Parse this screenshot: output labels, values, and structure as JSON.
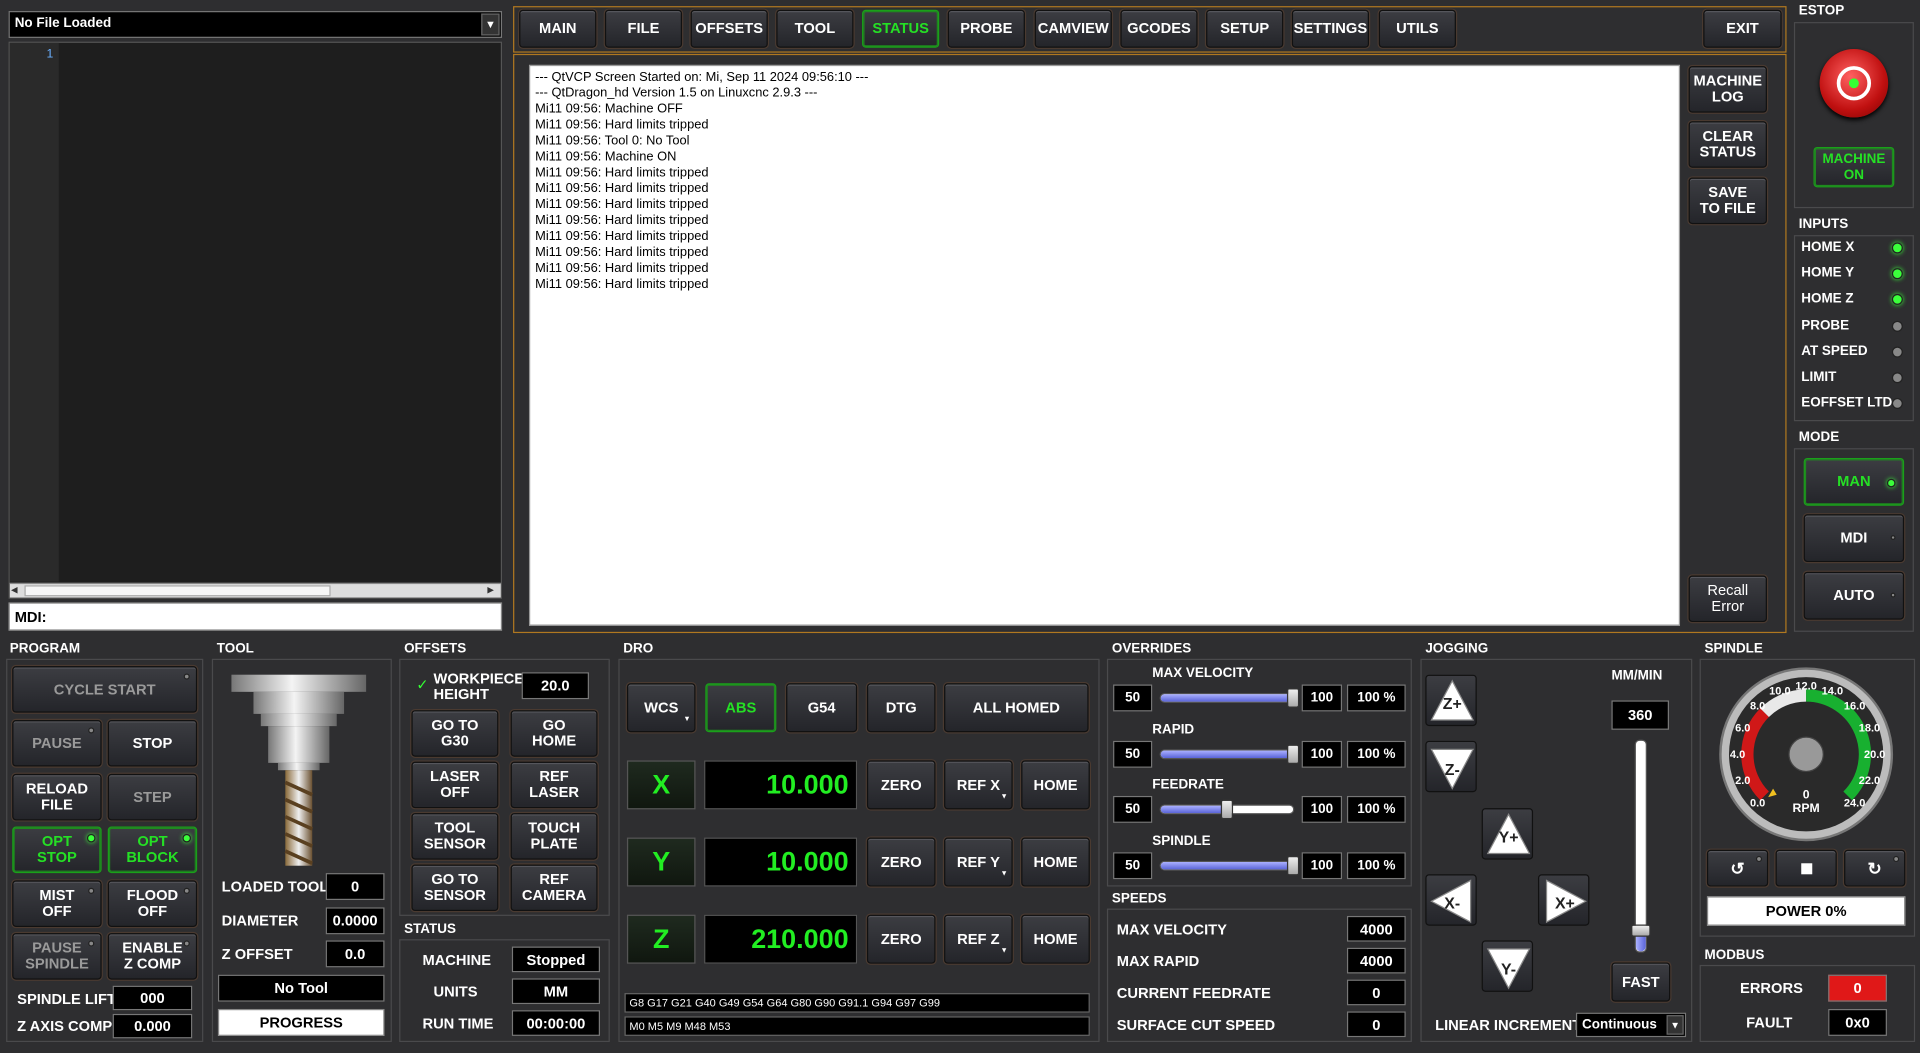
{
  "file": {
    "name": "No File Loaded",
    "line_no": "1",
    "mdi_label": "MDI:"
  },
  "tabs": [
    "MAIN",
    "FILE",
    "OFFSETS",
    "TOOL",
    "STATUS",
    "PROBE",
    "CAMVIEW",
    "GCODES",
    "SETUP",
    "SETTINGS",
    "UTILS"
  ],
  "exit_label": "EXIT",
  "log": [
    "--- QtVCP Screen Started on: Mi, Sep 11 2024 09:56:10 ---",
    "--- QtDragon_hd Version 1.5 on Linuxcnc 2.9.3 ---",
    "Mi11 09:56: Machine OFF",
    "Mi11 09:56: Hard limits tripped",
    "Mi11 09:56: Tool 0: No Tool",
    "Mi11 09:56: Machine ON",
    "Mi11 09:56: Hard limits tripped",
    "Mi11 09:56: Hard limits tripped",
    "Mi11 09:56: Hard limits tripped",
    "Mi11 09:56: Hard limits tripped",
    "Mi11 09:56: Hard limits tripped",
    "Mi11 09:56: Hard limits tripped",
    "Mi11 09:56: Hard limits tripped",
    "Mi11 09:56: Hard limits tripped"
  ],
  "log_buttons": {
    "machine_log": "MACHINE\nLOG",
    "clear_status": "CLEAR\nSTATUS",
    "save_to_file": "SAVE\nTO FILE",
    "recall_error": "Recall\nError"
  },
  "estop": {
    "title": "ESTOP",
    "machine_on": "MACHINE\nON"
  },
  "inputs": {
    "title": "INPUTS",
    "items": [
      {
        "label": "HOME X",
        "on": true
      },
      {
        "label": "HOME Y",
        "on": true
      },
      {
        "label": "HOME Z",
        "on": true
      },
      {
        "label": "PROBE",
        "on": false
      },
      {
        "label": "AT SPEED",
        "on": false
      },
      {
        "label": "LIMIT",
        "on": false
      },
      {
        "label": "EOFFSET LTD",
        "on": false
      }
    ]
  },
  "mode": {
    "title": "MODE",
    "man": "MAN",
    "mdi": "MDI",
    "auto": "AUTO"
  },
  "program": {
    "title": "PROGRAM",
    "cycle_start": "CYCLE START",
    "pause": "PAUSE",
    "stop": "STOP",
    "reload": "RELOAD\nFILE",
    "step": "STEP",
    "opt_stop": "OPT\nSTOP",
    "opt_block": "OPT\nBLOCK",
    "mist": "MIST\nOFF",
    "flood": "FLOOD\nOFF",
    "pause_spindle": "PAUSE\nSPINDLE",
    "enable_zcomp": "ENABLE\nZ COMP",
    "spindle_lift_label": "SPINDLE LIFT",
    "spindle_lift": "000",
    "z_axis_comp_label": "Z AXIS COMP",
    "z_axis_comp": "0.000"
  },
  "tool": {
    "title": "TOOL",
    "loaded_tool_label": "LOADED TOOL",
    "loaded_tool": "0",
    "diameter_label": "DIAMETER",
    "diameter": "0.0000",
    "z_offset_label": "Z OFFSET",
    "z_offset": "0.0",
    "tool_name": "No Tool",
    "progress": "PROGRESS"
  },
  "offsets": {
    "title": "OFFSETS",
    "workpiece_height_label": "WORKPIECE\nHEIGHT",
    "workpiece_height": "20.0",
    "go_g30": "GO TO\nG30",
    "go_home": "GO\nHOME",
    "laser_off": "LASER\nOFF",
    "ref_laser": "REF\nLASER",
    "tool_sensor": "TOOL\nSENSOR",
    "touch_plate": "TOUCH\nPLATE",
    "go_sensor": "GO TO\nSENSOR",
    "ref_camera": "REF\nCAMERA"
  },
  "status": {
    "title": "STATUS",
    "machine_label": "MACHINE",
    "machine": "Stopped",
    "units_label": "UNITS",
    "units": "MM",
    "run_time_label": "RUN TIME",
    "run_time": "00:00:00"
  },
  "dro": {
    "title": "DRO",
    "wcs": "WCS",
    "abs": "ABS",
    "g54": "G54",
    "dtg": "DTG",
    "all_homed": "ALL HOMED",
    "axes": [
      {
        "name": "X",
        "value": "10.000",
        "ref": "REF X"
      },
      {
        "name": "Y",
        "value": "10.000",
        "ref": "REF Y"
      },
      {
        "name": "Z",
        "value": "210.000",
        "ref": "REF Z"
      }
    ],
    "zero": "ZERO",
    "home": "HOME",
    "gcodes": "G8 G17 G21 G40 G49 G54 G64 G80 G90 G91.1 G94 G97 G99",
    "mcodes": "M0 M5 M9 M48 M53"
  },
  "overrides": {
    "title": "OVERRIDES",
    "items": [
      {
        "label": "MAX VELOCITY",
        "min": "50",
        "max": "100",
        "pct": "100 %",
        "level": 1.0
      },
      {
        "label": "RAPID",
        "min": "50",
        "max": "100",
        "pct": "100 %",
        "level": 1.0
      },
      {
        "label": "FEEDRATE",
        "min": "50",
        "max": "100",
        "pct": "100 %",
        "level": 0.5
      },
      {
        "label": "SPINDLE",
        "min": "50",
        "max": "100",
        "pct": "100 %",
        "level": 1.0
      }
    ]
  },
  "speeds": {
    "title": "SPEEDS",
    "items": [
      {
        "label": "MAX VELOCITY",
        "value": "4000"
      },
      {
        "label": "MAX RAPID",
        "value": "4000"
      },
      {
        "label": "CURRENT FEEDRATE",
        "value": "0"
      },
      {
        "label": "SURFACE CUT SPEED",
        "value": "0"
      }
    ]
  },
  "jogging": {
    "title": "JOGGING",
    "units": "MM/MIN",
    "rate": "360",
    "fast": "FAST",
    "increment_label": "LINEAR INCREMENT",
    "increment": "Continuous",
    "buttons": [
      "Z+",
      "Z-",
      "Y+",
      "X-",
      "X+",
      "Y-"
    ]
  },
  "spindle": {
    "title": "SPINDLE",
    "ticks": [
      "0.0",
      "2.0",
      "4.0",
      "6.0",
      "8.0",
      "10.0",
      "12.0",
      "14.0",
      "16.0",
      "18.0",
      "20.0",
      "22.0",
      "24.0"
    ],
    "rpm_value": "0",
    "rpm_label": "RPM",
    "power": "POWER 0%"
  },
  "modbus": {
    "title": "MODBUS",
    "errors_label": "ERRORS",
    "errors": "0",
    "fault_label": "FAULT",
    "fault": "0x0"
  },
  "colors": {
    "accent_green": "#25e025",
    "frame_orange": "#b07820",
    "error_red": "#e01818"
  }
}
